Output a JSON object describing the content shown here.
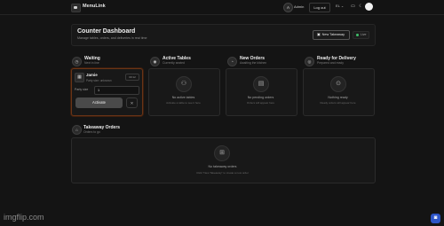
{
  "app": {
    "brand": "MenuLink"
  },
  "topbar": {
    "avatar_initial": "A",
    "username": "Admin",
    "logout_label": "Log out",
    "language": "EL ⌄",
    "icons": [
      "screen-icon",
      "moon-icon"
    ]
  },
  "header": {
    "title": "Counter Dashboard",
    "subtitle": "Manage tables, orders, and deliveries in real time",
    "new_takeaway_label": "New Takeaway",
    "live_label": "Live"
  },
  "columns": {
    "waiting": {
      "title": "Waiting",
      "subtitle": "Next in line"
    },
    "active": {
      "title": "Active Tables",
      "subtitle": "Currently seated",
      "empty_title": "No active tables",
      "empty_sub": "Activate a table to see it here"
    },
    "new_orders": {
      "title": "New Orders",
      "subtitle": "Awaiting the kitchen",
      "empty_title": "No pending orders",
      "empty_sub": "Orders will appear here"
    },
    "ready": {
      "title": "Ready for Delivery",
      "subtitle": "Prepared and ready",
      "empty_title": "Nothing ready",
      "empty_sub": "Ready orders will appear here"
    }
  },
  "waiting_item": {
    "name": "Jamie",
    "meta": "Party size: unknown",
    "time": "00:12",
    "party_label": "Party size",
    "party_value": "1",
    "activate_label": "Activate",
    "close_symbol": "✕"
  },
  "takeaway": {
    "title": "Takeaway Orders",
    "subtitle": "Orders to go",
    "empty_title": "No takeaway orders",
    "empty_sub": "Click \"New Takeaway\" to create a new order"
  },
  "watermark": "imgflip.com"
}
